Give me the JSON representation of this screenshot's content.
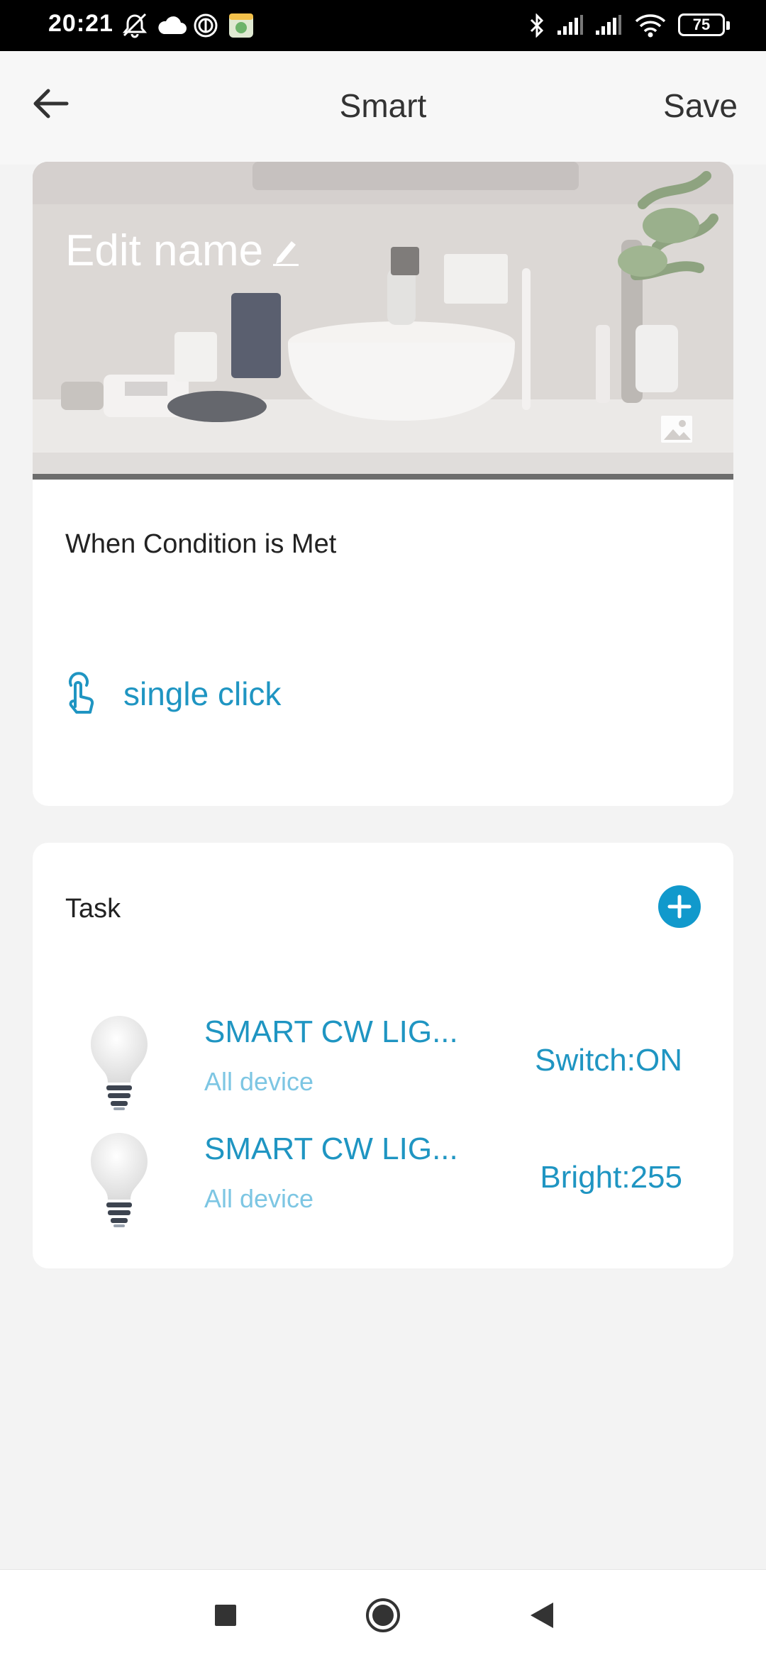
{
  "status_bar": {
    "time": "20:21",
    "battery": "75",
    "left_icons": [
      "mute-icon",
      "cloud-icon",
      "nfc-icon",
      "app-notification-icon"
    ],
    "right_icons": [
      "bluetooth-icon",
      "signal-icon",
      "signal-icon",
      "wifi-icon",
      "battery-icon"
    ]
  },
  "header": {
    "title": "Smart",
    "save_label": "Save"
  },
  "cover": {
    "title": "Edit name"
  },
  "condition": {
    "label": "When Condition is Met",
    "item": "single click"
  },
  "task": {
    "label": "Task",
    "items": [
      {
        "name": "SMART CW LIG...",
        "sub": "All device",
        "action": "Switch:ON"
      },
      {
        "name": "SMART CW LIG...",
        "sub": "All device",
        "action": "Bright:255"
      }
    ]
  },
  "colors": {
    "accent": "#1f95c2",
    "accent_light": "#7dc6e3",
    "add_button": "#1199cc",
    "page_background": "#f3f3f3"
  }
}
